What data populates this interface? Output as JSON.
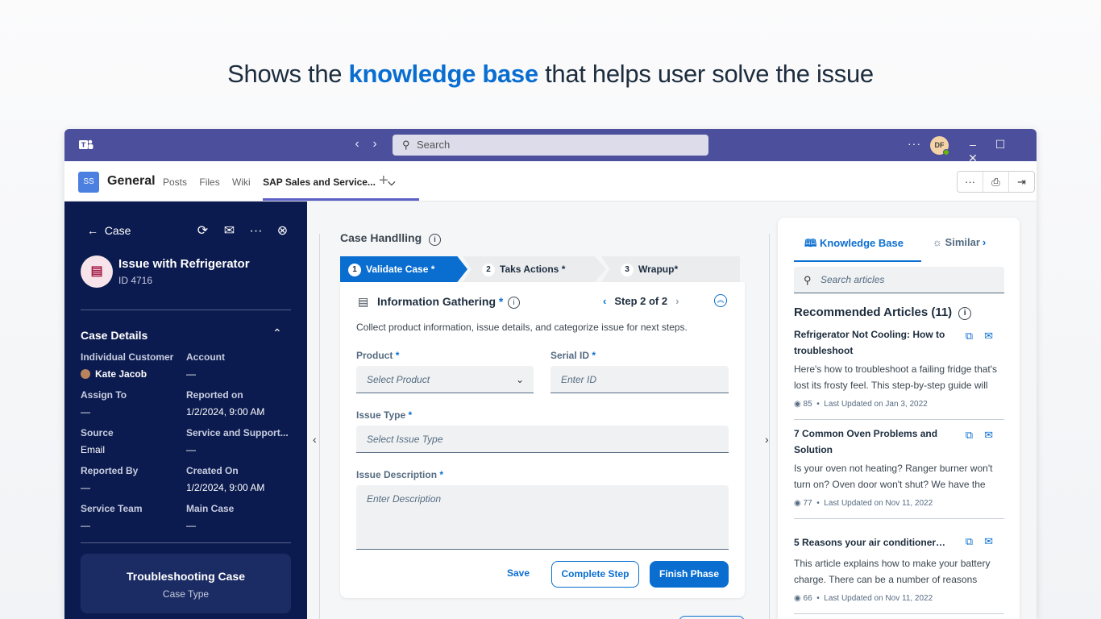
{
  "headline": {
    "pre": "Shows the ",
    "highlight": "knowledge base",
    "post": " that helps user solve the issue"
  },
  "titlebar": {
    "search_placeholder": "Search",
    "avatar": "DF",
    "more": "···"
  },
  "tabbar": {
    "team_badge": "SS",
    "channel": "General",
    "tabs": [
      "Posts",
      "Files",
      "Wiki"
    ],
    "active_tab": "SAP Sales and Service...",
    "active_chevron": "⌵",
    "plus": "+"
  },
  "case": {
    "back_label": "Case",
    "title": "Issue with Refrigerator",
    "id": "ID 4716",
    "details_title": "Case Details",
    "fields": [
      {
        "label": "Individual Customer",
        "value": "Kate Jacob"
      },
      {
        "label": "Account",
        "value": "—"
      },
      {
        "label": "Assign To",
        "value": "—"
      },
      {
        "label": "Reported on",
        "value": "1/2/2024, 9:00 AM"
      },
      {
        "label": "Source",
        "value": "Email"
      },
      {
        "label": "Service and Support...",
        "value": "—"
      },
      {
        "label": "Reported By",
        "value": "—"
      },
      {
        "label": "Created On",
        "value": "1/2/2024, 9:00 AM"
      },
      {
        "label": "Service Team",
        "value": "—"
      },
      {
        "label": "Main Case",
        "value": "—"
      }
    ],
    "case_type_value": "Troubleshooting Case",
    "case_type_label": "Case Type"
  },
  "handling": {
    "title": "Case Handlling",
    "steps": [
      {
        "num": "1",
        "label": "Validate Case *"
      },
      {
        "num": "2",
        "label": "Taks Actions *"
      },
      {
        "num": "3",
        "label": "Wrapup*"
      }
    ],
    "section_title": "Information Gathering",
    "required_mark": "*",
    "step_indicator": "Step 2 of 2",
    "description": "Collect product information, issue details, and categorize issue for next steps.",
    "product_label": "Product",
    "product_placeholder": "Select Product",
    "serial_label": "Serial ID",
    "serial_placeholder": "Enter ID",
    "issue_type_label": "Issue Type",
    "issue_type_placeholder": "Select Issue Type",
    "issue_desc_label": "Issue Description",
    "issue_desc_placeholder": "Enter Description",
    "save_label": "Save",
    "complete_label": "Complete Step",
    "finish_label": "Finish Phase"
  },
  "kb": {
    "tab_active": "Knowledge Base",
    "tab_other": "Similar",
    "search_placeholder": "Search articles",
    "rec_title": "Recommended Articles (11)",
    "articles": [
      {
        "title": "Refrigerator Not Cooling: How to troubleshoot",
        "desc": "Here's how to troubleshoot a failing fridge that's lost its frosty feel. This step-by-step guide will sh...",
        "views": "85",
        "updated": "Last Updated on Jan 3, 2022"
      },
      {
        "title": "7 Common Oven Problems and Solution",
        "desc": "Is your oven not heating? Ranger burner won't turn on? Oven door won't shut? We have the sol...",
        "views": "77",
        "updated": "Last Updated on Nov 11, 2022"
      },
      {
        "title": "5 Reasons your air conditioner i...",
        "desc": "This article explains how to make your battery charge. There can be a number of reasons behin...",
        "views": "66",
        "updated": "Last Updated on Nov 11, 2022"
      }
    ]
  },
  "colors": {
    "teams_purple": "#4b4f9c",
    "sap_blue": "#0a6ed1",
    "shell_navy": "#0c1b4f"
  }
}
